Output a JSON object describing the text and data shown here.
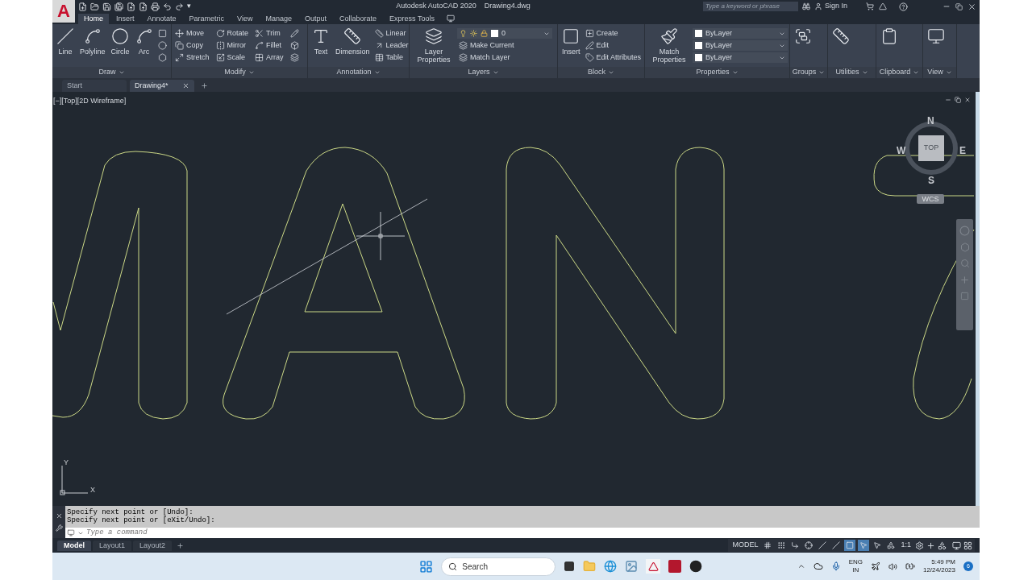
{
  "logo": "A",
  "quick_access_caret": "▾",
  "title": "Autodesk AutoCAD 2020",
  "file_name": "Drawing4.dwg",
  "search": {
    "placeholder": "Type a keyword or phrase"
  },
  "sign_in": "Sign In",
  "ribbon_tabs": [
    {
      "label": "Home",
      "selected": true
    },
    {
      "label": "Insert",
      "selected": false
    },
    {
      "label": "Annotate",
      "selected": false
    },
    {
      "label": "Parametric",
      "selected": false
    },
    {
      "label": "View",
      "selected": false
    },
    {
      "label": "Manage",
      "selected": false
    },
    {
      "label": "Output",
      "selected": false
    },
    {
      "label": "Collaborate",
      "selected": false
    },
    {
      "label": "Express Tools",
      "selected": false
    }
  ],
  "ribbon_panels": [
    {
      "title": "Draw",
      "tools": [
        {
          "kind": "large",
          "label": "Line"
        },
        {
          "kind": "large",
          "label": "Polyline"
        },
        {
          "kind": "large",
          "label": "Circle"
        },
        {
          "kind": "large",
          "label": "Arc"
        },
        {
          "kind": "small"
        },
        {
          "kind": "small"
        },
        {
          "kind": "small"
        }
      ]
    },
    {
      "title": "Modify",
      "tools": [
        {
          "kind": "small",
          "label": "Move"
        },
        {
          "kind": "small",
          "label": "Copy"
        },
        {
          "kind": "small",
          "label": "Stretch"
        },
        {
          "kind": "small",
          "label": "Rotate"
        },
        {
          "kind": "small",
          "label": "Mirror"
        },
        {
          "kind": "small",
          "label": "Scale"
        },
        {
          "kind": "small",
          "label": "Trim"
        },
        {
          "kind": "small",
          "label": "Fillet"
        },
        {
          "kind": "small",
          "label": "Array"
        },
        {
          "kind": "small"
        },
        {
          "kind": "small"
        },
        {
          "kind": "small"
        }
      ]
    },
    {
      "title": "Annotation",
      "tools": [
        {
          "kind": "large",
          "label": "Text"
        },
        {
          "kind": "large",
          "label": "Dimension"
        },
        {
          "kind": "small",
          "label": "Linear"
        },
        {
          "kind": "small",
          "label": "Leader"
        },
        {
          "kind": "small",
          "label": "Table"
        }
      ]
    },
    {
      "title": "Layers",
      "tools": [
        {
          "kind": "large",
          "label": "Layer Properties"
        },
        {
          "kind": "dropdown",
          "label": "0"
        },
        {
          "kind": "small",
          "label": "Make Current"
        },
        {
          "kind": "small",
          "label": "Match Layer"
        }
      ]
    },
    {
      "title": "Block",
      "tools": [
        {
          "kind": "large",
          "label": "Insert"
        },
        {
          "kind": "small",
          "label": "Create"
        },
        {
          "kind": "small",
          "label": "Edit"
        },
        {
          "kind": "small",
          "label": "Edit Attributes"
        }
      ]
    },
    {
      "title": "Properties",
      "tools": [
        {
          "kind": "large",
          "label": "Match Properties"
        },
        {
          "kind": "dropdown",
          "label": "ByLayer"
        },
        {
          "kind": "dropdown",
          "label": "ByLayer"
        },
        {
          "kind": "dropdown",
          "label": "ByLayer"
        }
      ]
    },
    {
      "title": "Groups",
      "tools": [
        {
          "kind": "large"
        }
      ]
    },
    {
      "title": "Utilities",
      "tools": [
        {
          "kind": "large"
        }
      ]
    },
    {
      "title": "Clipboard",
      "tools": [
        {
          "kind": "large"
        }
      ]
    },
    {
      "title": "View",
      "tools": [
        {
          "kind": "large"
        }
      ]
    }
  ],
  "file_tabs": [
    {
      "label": "Start",
      "selected": false
    },
    {
      "label": "Drawing4*",
      "selected": true
    }
  ],
  "viewport": {
    "label": "[−][Top][2D Wireframe]"
  },
  "viewcube": {
    "north": "N",
    "south": "S",
    "west": "W",
    "east": "E",
    "face": "TOP",
    "ucs": "WCS"
  },
  "ucs_icon": {
    "y": "Y",
    "x": "X"
  },
  "command_history": [
    "Specify next point or [Undo]:",
    "Specify next point or [eXit/Undo]:"
  ],
  "command_input": {
    "placeholder": "Type a command"
  },
  "layout_tabs": [
    {
      "label": "Model",
      "selected": true
    },
    {
      "label": "Layout1",
      "selected": false
    },
    {
      "label": "Layout2",
      "selected": false
    }
  ],
  "status_bar": {
    "space": "MODEL",
    "scale": "1:1",
    "toggles": [
      {
        "on": false
      },
      {
        "on": false
      },
      {
        "on": false
      },
      {
        "on": false
      },
      {
        "on": false
      },
      {
        "on": false
      },
      {
        "on": true
      },
      {
        "on": true
      },
      {
        "on": false
      },
      {
        "on": false
      }
    ]
  },
  "taskbar": {
    "search": {
      "placeholder": "Search"
    },
    "language": "ENG",
    "region": "IN",
    "time": "5:49 PM",
    "date": "12/24/2023",
    "notifications": "6"
  }
}
